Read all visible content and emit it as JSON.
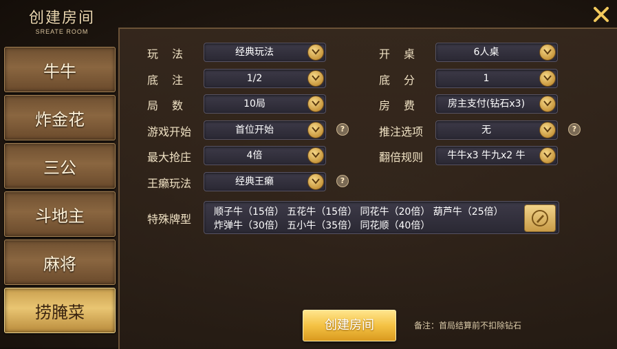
{
  "header": {
    "title": "创建房间",
    "subtitle": "SREATE ROOM",
    "close_icon": "close-icon"
  },
  "sidebar": {
    "items": [
      {
        "label": "牛牛",
        "active": false
      },
      {
        "label": "炸金花",
        "active": false
      },
      {
        "label": "三公",
        "active": false
      },
      {
        "label": "斗地主",
        "active": false
      },
      {
        "label": "麻将",
        "active": false
      },
      {
        "label": "捞腌菜",
        "active": true
      }
    ]
  },
  "form": {
    "play_mode": {
      "label": "玩法",
      "value": "经典玩法"
    },
    "base_bet": {
      "label": "底注",
      "value": "1/2"
    },
    "rounds": {
      "label": "局数",
      "value": "10局"
    },
    "game_start": {
      "label": "游戏开始",
      "value": "首位开始"
    },
    "max_banker": {
      "label": "最大抢庄",
      "value": "4倍"
    },
    "wild_mode": {
      "label": "王癞玩法",
      "value": "经典王癞"
    },
    "table": {
      "label": "开桌",
      "value": "6人桌"
    },
    "base_score": {
      "label": "底分",
      "value": "1"
    },
    "room_fee": {
      "label": "房费",
      "value": "房主支付(钻石x3)"
    },
    "push_bet": {
      "label": "推注选项",
      "value": "无"
    },
    "double_rule": {
      "label": "翻倍规则",
      "value": "牛牛x3 牛九x2 牛"
    },
    "special": {
      "label": "特殊牌型",
      "line1": "顺子牛（15倍） 五花牛（15倍） 同花牛（20倍） 葫芦牛（25倍）",
      "line2": "炸弹牛（30倍） 五小牛（35倍） 同花顺（40倍）"
    }
  },
  "footer": {
    "create_label": "创建房间",
    "note": "备注：首局结算前不扣除钻石"
  },
  "colors": {
    "accent_gold": "#e9c572",
    "panel_bg": "#2a2833"
  }
}
